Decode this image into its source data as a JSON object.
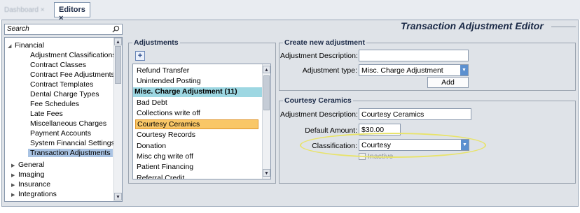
{
  "tabs": [
    {
      "label": "Dashboard ×"
    },
    {
      "label": "Editors ×"
    }
  ],
  "search": {
    "placeholder": "Search"
  },
  "tree": {
    "root_expanded": "Financial",
    "children": [
      "Adjustment Classifications",
      "Contract Classes",
      "Contract Fee Adjustments",
      "Contract Templates",
      "Dental Charge Types",
      "Fee Schedules",
      "Late Fees",
      "Miscellaneous Charges",
      "Payment Accounts",
      "System Financial Settings",
      "Transaction Adjustments"
    ],
    "collapsed": [
      "General",
      "Imaging",
      "Insurance",
      "Integrations"
    ],
    "selected": "Transaction Adjustments"
  },
  "editor": {
    "title": "Transaction Adjustment Editor"
  },
  "adjustments": {
    "group_label": "Adjustments",
    "add_icon": "plus-icon",
    "items": [
      {
        "label": "Refund Transfer",
        "kind": "item"
      },
      {
        "label": "Unintended Posting",
        "kind": "item"
      },
      {
        "label": "Misc. Charge Adjustment (11)",
        "kind": "group"
      },
      {
        "label": "Bad Debt",
        "kind": "item"
      },
      {
        "label": "Collections write off",
        "kind": "item"
      },
      {
        "label": "Courtesy Ceramics",
        "kind": "selected"
      },
      {
        "label": "Courtesy Records",
        "kind": "item"
      },
      {
        "label": "Donation",
        "kind": "item"
      },
      {
        "label": "Misc chg write off",
        "kind": "item"
      },
      {
        "label": "Patient Financing",
        "kind": "item"
      },
      {
        "label": "Referral Credit",
        "kind": "item"
      }
    ]
  },
  "create_new": {
    "group_label": "Create new adjustment",
    "description_label": "Adjustment Description:",
    "description_value": "",
    "type_label": "Adjustment type:",
    "type_value": "Misc. Charge Adjustment",
    "add_label": "Add"
  },
  "detail": {
    "group_label": "Courtesy Ceramics",
    "description_label": "Adjustment Description:",
    "description_value": "Courtesy Ceramics",
    "amount_label": "Default Amount:",
    "amount_value": "$30.00",
    "classification_label": "Classification:",
    "classification_value": "Courtesy",
    "inactive_label": "Inactive",
    "inactive_checked": false
  },
  "colors": {
    "group_row": "#9dd7e2",
    "selected_row": "#f9c767",
    "tree_selected": "#a9c3e3",
    "highlight_ring": "#e8e36a"
  }
}
